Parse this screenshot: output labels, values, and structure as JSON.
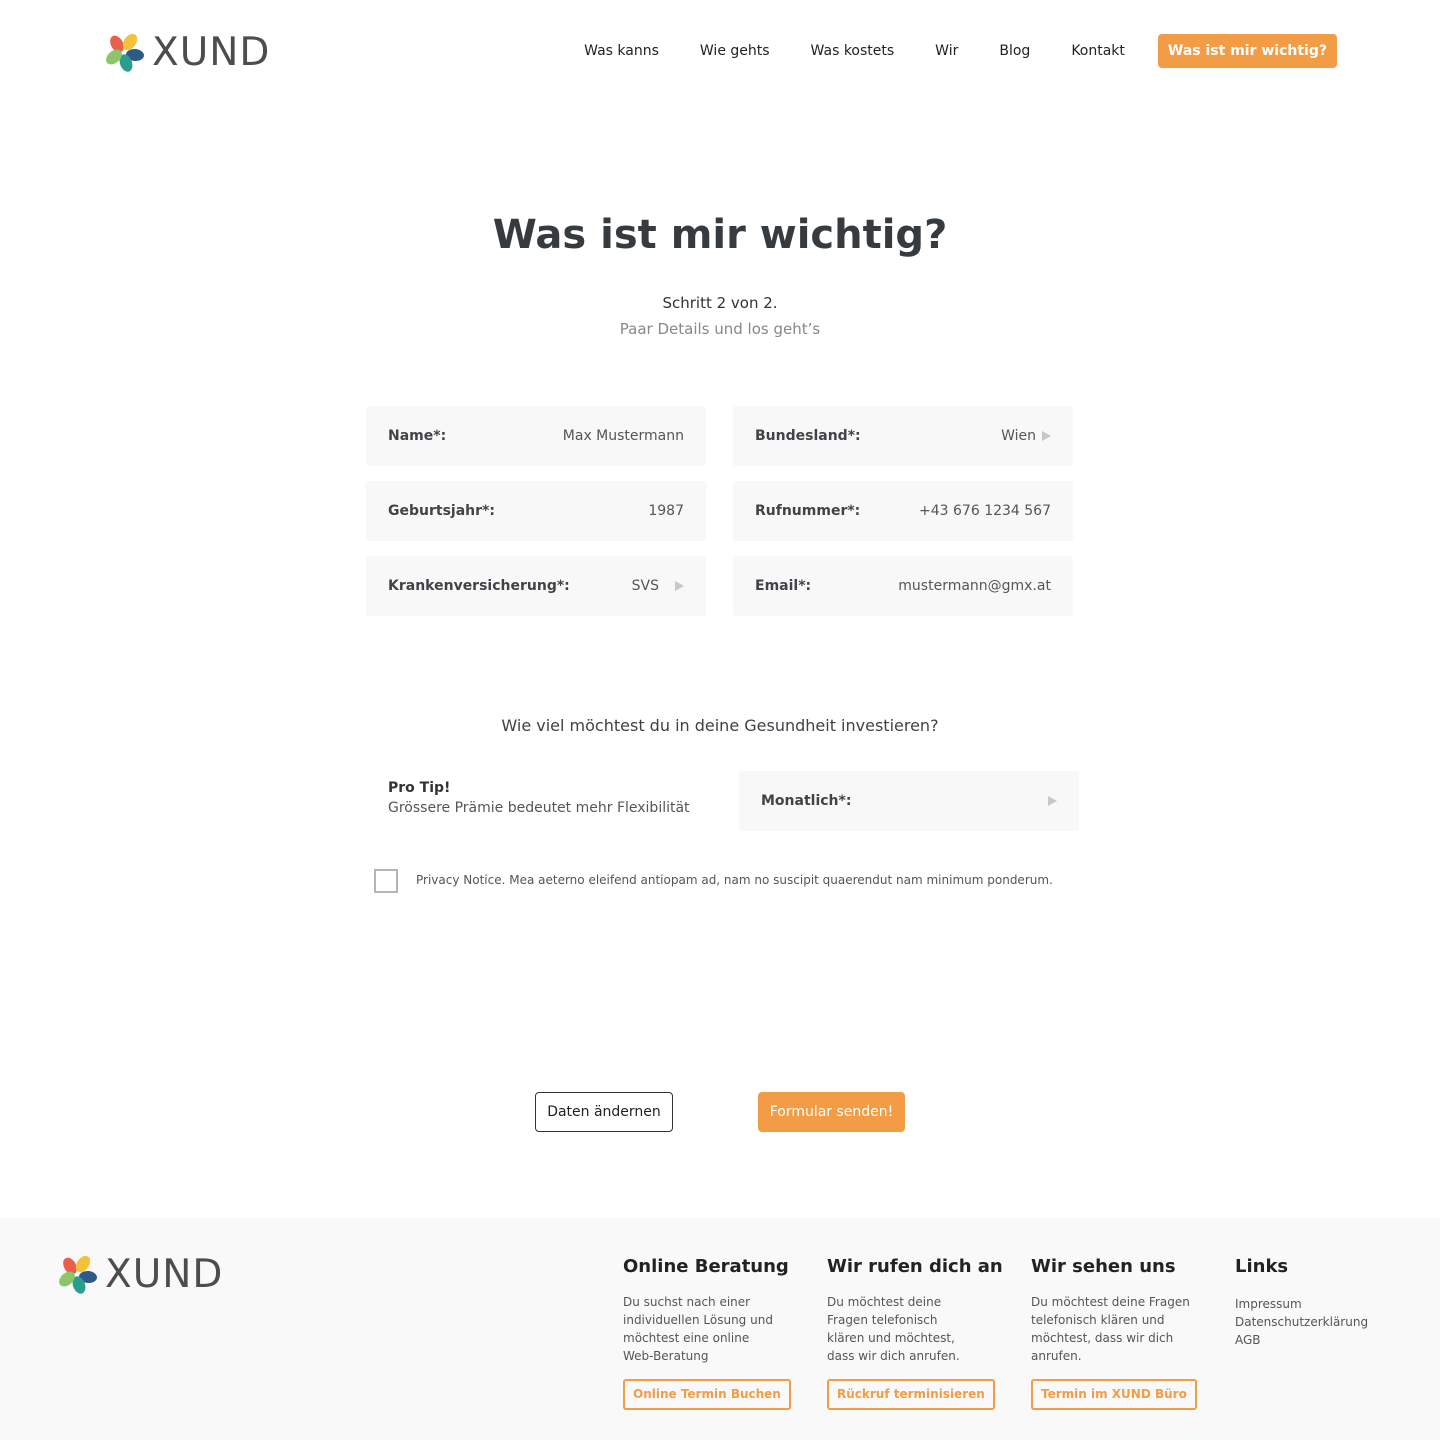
{
  "header": {
    "logo_text": "XUND",
    "nav": [
      {
        "label": "Was kanns"
      },
      {
        "label": "Wie gehts"
      },
      {
        "label": "Was kostets"
      },
      {
        "label": "Wir"
      },
      {
        "label": "Blog"
      },
      {
        "label": "Kontakt"
      }
    ],
    "cta_label": "Was ist mir wichtig?"
  },
  "main": {
    "title": "Was ist mir wichtig?",
    "step": "Schritt 2 von 2.",
    "substep": "Paar Details und los geht’s",
    "fields": {
      "name": {
        "label": "Name*:",
        "value": "Max Mustermann"
      },
      "bundesland": {
        "label": "Bundesland*:",
        "value": "Wien"
      },
      "geburtsjahr": {
        "label": "Geburtsjahr*:",
        "value": "1987"
      },
      "rufnummer": {
        "label": "Rufnummer*:",
        "value": "+43 676 1234 567"
      },
      "krankenversicherung": {
        "label": "Krankenversicherung*:",
        "value": "SVS"
      },
      "email": {
        "label": "Email*:",
        "value": "mustermann@gmx.at"
      },
      "monatlich": {
        "label": "Monatlich*:",
        "value": ""
      }
    },
    "question": "Wie viel möchtest du in deine Gesundheit investieren?",
    "protip_title": "Pro Tip!",
    "protip_text": "Grössere Prämie bedeutet mehr Flexibilität",
    "privacy_notice": "Privacy Notice. Mea aeterno eleifend antiopam ad, nam no suscipit quaerendut nam minimum ponderum.",
    "privacy_checked": false,
    "btn_change": "Daten ändernen",
    "btn_submit": "Formular senden!"
  },
  "footer": {
    "logo_text": "XUND",
    "columns": [
      {
        "title": "Online Beratung",
        "text": "Du suchst nach einer individuellen Lösung und möchtest eine online Web-Beratung",
        "button": "Online Termin Buchen"
      },
      {
        "title": "Wir rufen dich an",
        "text": "Du möchtest deine Fragen telefonisch klären und möchtest, dass wir dich anrufen.",
        "button": "Rückruf terminisieren"
      },
      {
        "title": "Wir sehen uns",
        "text": "Du möchtest deine Fragen telefonisch klären und möchtest, dass wir dich anrufen.",
        "button": "Termin im XUND Büro"
      }
    ],
    "links_title": "Links",
    "links": [
      "Impressum",
      "Datenschutzerklärung",
      "AGB"
    ]
  },
  "colors": {
    "accent": "#f39c46",
    "field_bg": "#f8f8f8",
    "footer_bg": "#f9f9f9",
    "heading": "#353b3f"
  }
}
